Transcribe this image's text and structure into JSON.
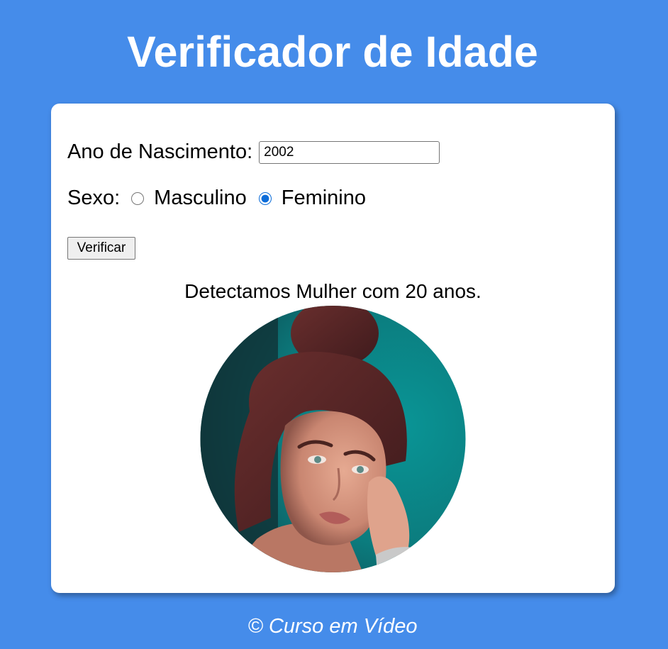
{
  "header": {
    "title": "Verificador de Idade"
  },
  "form": {
    "year_label": "Ano de Nascimento:",
    "year_value": "2002",
    "sex_label": "Sexo:",
    "sex_options": [
      {
        "label": "Masculino",
        "checked": false
      },
      {
        "label": "Feminino",
        "checked": true
      }
    ],
    "verify_label": "Verificar"
  },
  "result": {
    "text": "Detectamos Mulher com 20 anos.",
    "photo_icon": "woman-photo"
  },
  "footer": {
    "text": "© Curso em Vídeo"
  },
  "colors": {
    "page_background": "#458cea",
    "card_background": "#ffffff",
    "radio_accent": "#0b6cd9"
  }
}
